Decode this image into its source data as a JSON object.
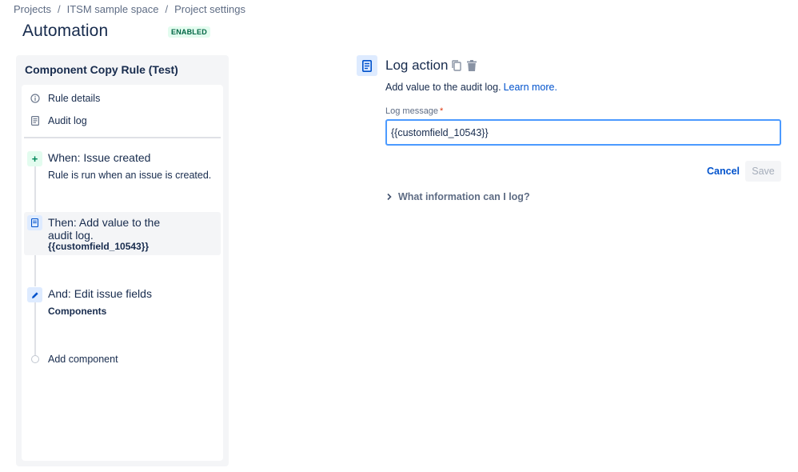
{
  "breadcrumb": {
    "items": [
      "Projects",
      "ITSM sample space",
      "Project settings"
    ],
    "separator": "/"
  },
  "header": {
    "title": "Automation",
    "status_badge": "ENABLED"
  },
  "rule": {
    "name": "Component Copy Rule (Test)",
    "nav": [
      {
        "label": "Rule details",
        "icon": "info-icon"
      },
      {
        "label": "Audit log",
        "icon": "document-icon"
      }
    ],
    "components": [
      {
        "title": "When: Issue created",
        "subtitle": "Rule is run when an issue is created.",
        "icon": "plus-icon",
        "kind": "trigger"
      },
      {
        "title": "Then: Add value to the audit log.",
        "subtitle": "{{customfield_10543}}",
        "icon": "document-icon",
        "kind": "action",
        "selected": true
      },
      {
        "title": "And: Edit issue fields",
        "subtitle": "Components",
        "icon": "pencil-icon",
        "kind": "action"
      }
    ],
    "add_component_label": "Add component"
  },
  "detail": {
    "title": "Log action",
    "description": "Add value to the audit log.",
    "learn_more": "Learn more.",
    "field_label": "Log message",
    "required_marker": "*",
    "field_value": "{{customfield_10543}}",
    "cancel_label": "Cancel",
    "save_label": "Save",
    "expander_label": "What information can I log?"
  },
  "colors": {
    "accent": "#0052cc",
    "focus_border": "#4c9aff",
    "enabled_bg": "#e3fcef",
    "enabled_text": "#006644",
    "panel_bg": "#f4f5f7"
  }
}
